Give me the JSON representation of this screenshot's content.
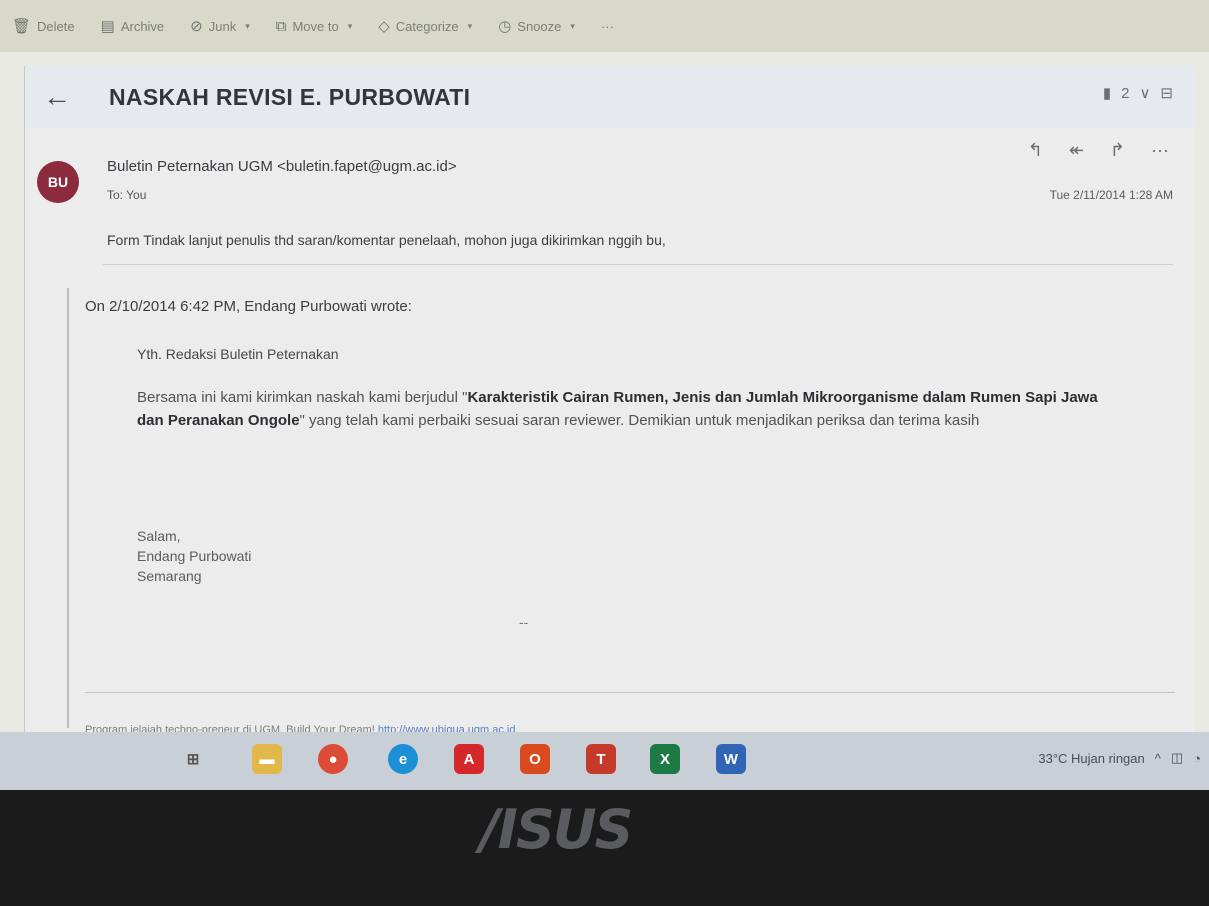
{
  "toolbar": {
    "items": [
      {
        "label": "Delete",
        "icon": "trash-icon"
      },
      {
        "label": "Archive",
        "icon": "archive-icon"
      },
      {
        "label": "Junk",
        "icon": "junk-icon"
      },
      {
        "label": "Move to",
        "icon": "move-to-icon"
      },
      {
        "label": "Categorize",
        "icon": "tag-icon"
      },
      {
        "label": "Snooze",
        "icon": "clock-icon"
      }
    ],
    "more": "···"
  },
  "email": {
    "subject": "NASKAH REVISI E. PURBOWATI",
    "thread_count": "2",
    "avatar_initials": "BU",
    "sender": "Buletin Peternakan UGM <buletin.fapet@ugm.ac.id>",
    "to": "To: You",
    "date": "Tue 2/11/2014 1:28 AM",
    "body": "Form Tindak lanjut penulis thd saran/komentar penelaah, mohon juga dikirimkan nggih bu,",
    "quoted": {
      "header": "On 2/10/2014 6:42 PM, Endang Purbowati wrote:",
      "greeting": "Yth. Redaksi Buletin Peternakan",
      "para_start": "Bersama ini kami kirimkan naskah kami berjudul \"",
      "para_bold": "Karakteristik Cairan Rumen, Jenis dan Jumlah Mikroorganisme dalam Rumen Sapi Jawa dan Peranakan Ongole",
      "para_end": "\" yang telah kami perbaiki sesuai saran reviewer.  Demikian untuk menjadikan periksa dan terima kasih",
      "sig_line1": "Salam,",
      "sig_line2": "Endang Purbowati",
      "sig_line3": "Semarang",
      "dash": "--"
    },
    "footer_text": "Program jelajah techno-preneur di UGM. Build Your Dream!",
    "footer_link": "http://www.ubiqua.ugm.ac.id"
  },
  "taskbar": {
    "weather": "33°C  Hujan ringan",
    "apps": [
      "task-view",
      "file-explorer",
      "chrome",
      "edge",
      "acrobat",
      "office",
      "teams",
      "excel",
      "word"
    ]
  },
  "laptop": {
    "brand": "/ISUS"
  },
  "colors": {
    "avatar": "#8c2a3e",
    "toolbar": "#d8d9c9",
    "taskbar": "#c9cfd6"
  }
}
